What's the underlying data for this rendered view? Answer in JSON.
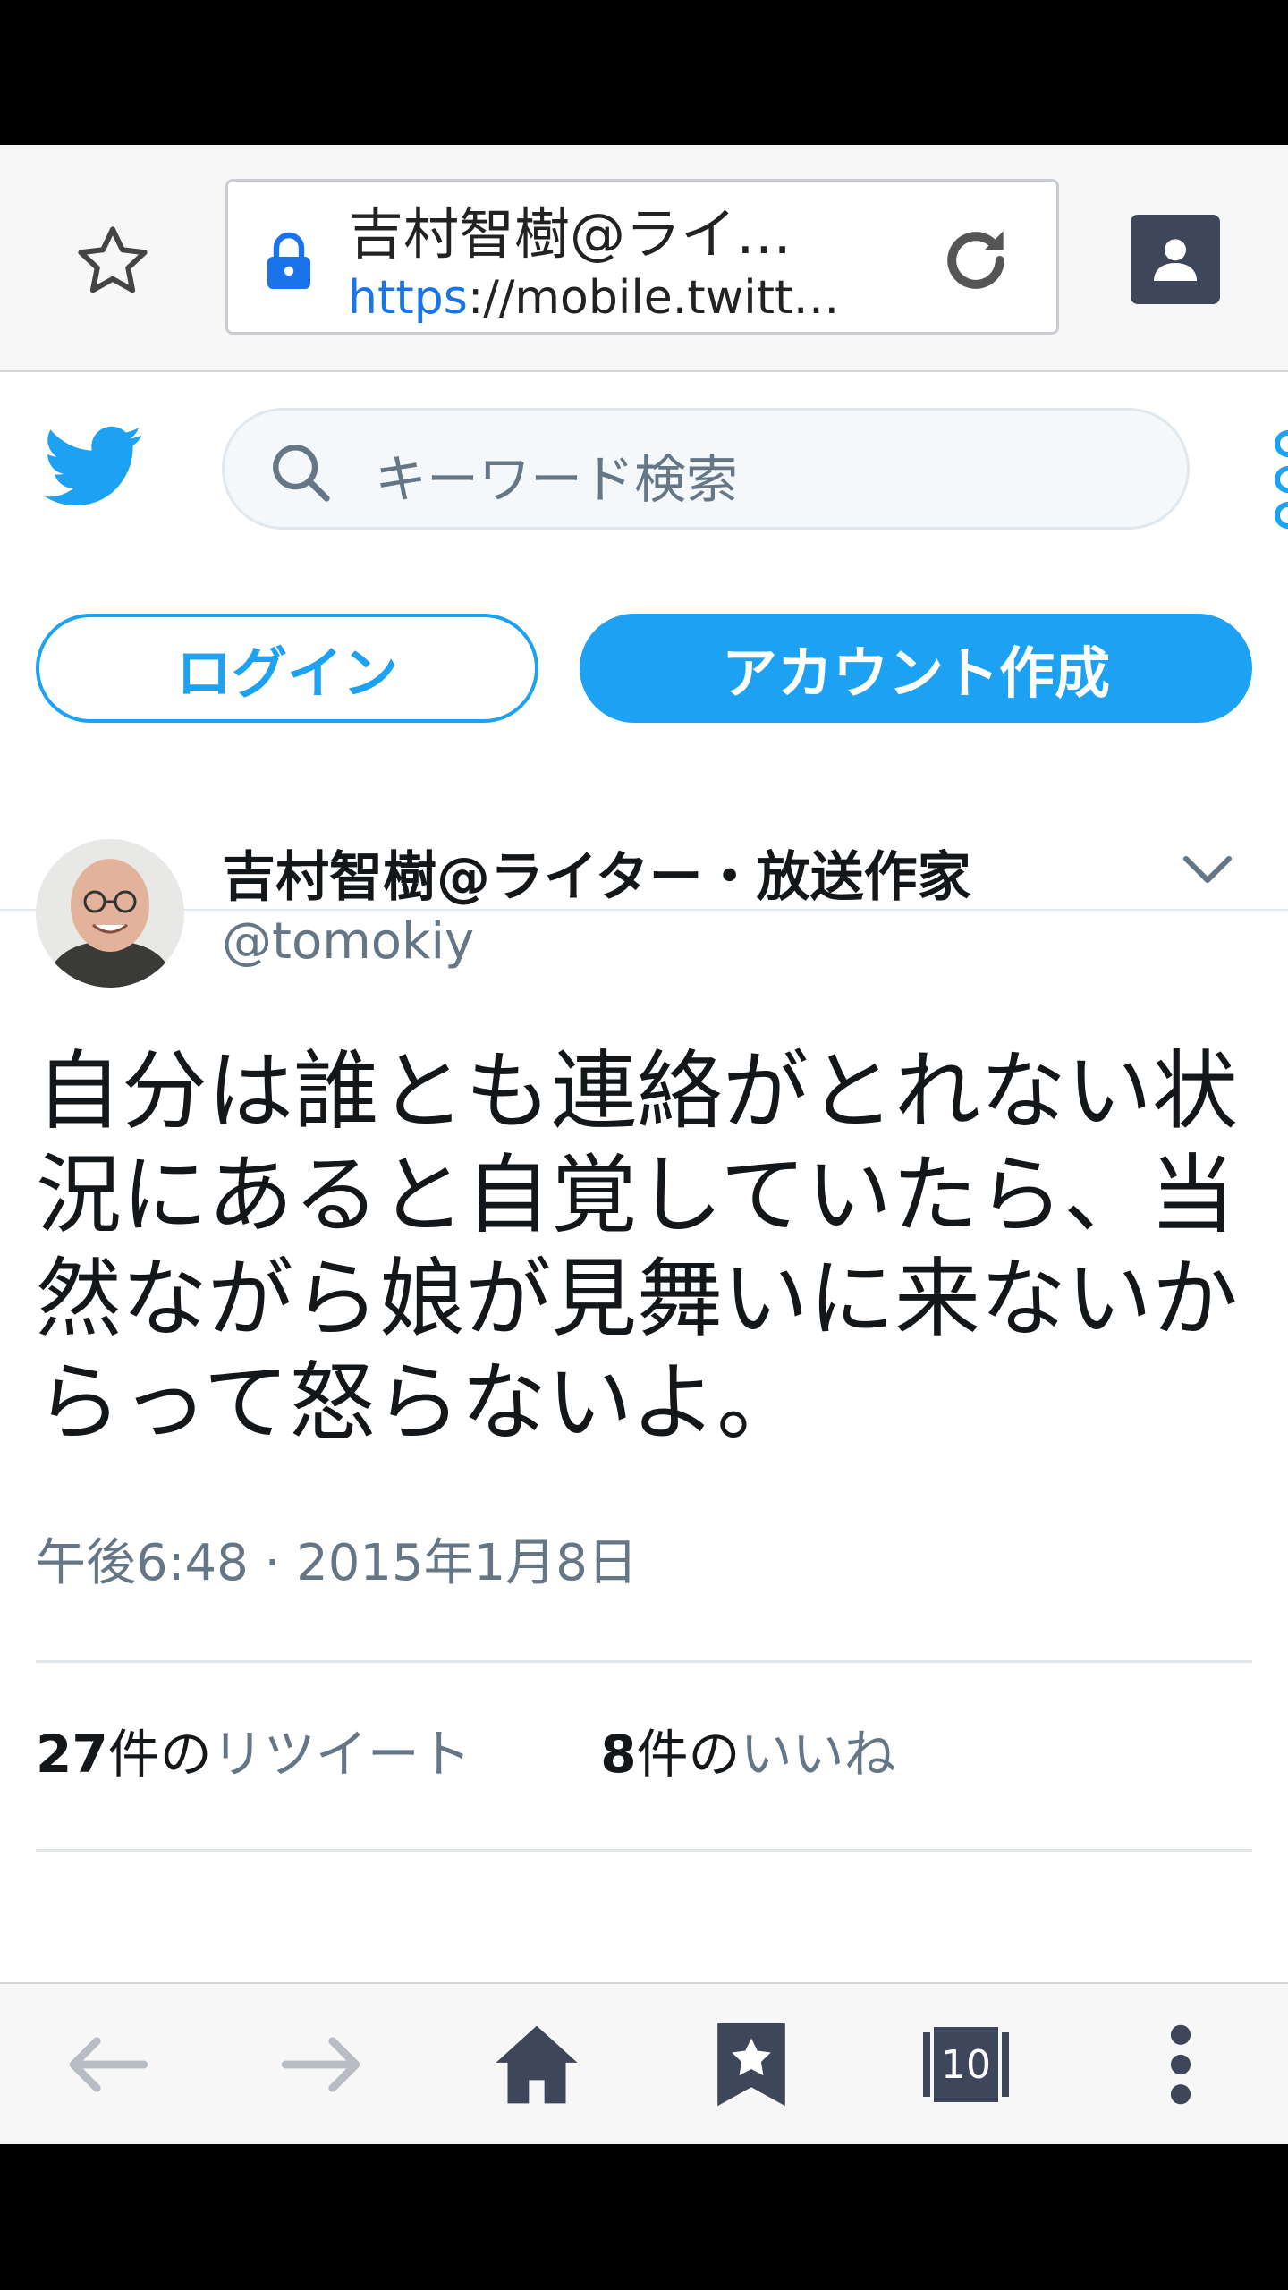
{
  "browser": {
    "page_title": "吉村智樹@ライ…",
    "url_scheme": "https",
    "url_rest": "://mobile.twitt…"
  },
  "twitter": {
    "search_placeholder": "キーワード検索",
    "login_label": "ログイン",
    "signup_label": "アカウント作成"
  },
  "tweet": {
    "author_name": "吉村智樹@ライター・放送作家",
    "author_handle": "@tomokiy",
    "text": "自分は誰とも連絡がとれない状況にあると自覚していたら、当然ながら娘が見舞いに来ないからって怒らないよ。",
    "timestamp": "午後6:48 · 2015年1月8日",
    "retweets": {
      "count": "27",
      "unit": "件の",
      "label": "リツイート"
    },
    "likes": {
      "count": "8",
      "unit": "件の",
      "label": "いいね"
    }
  },
  "bottom_nav": {
    "tab_count": "10"
  },
  "colors": {
    "twitter_blue": "#1da1f2",
    "secondary_text": "#657786",
    "chrome_icon": "#3d4759"
  }
}
